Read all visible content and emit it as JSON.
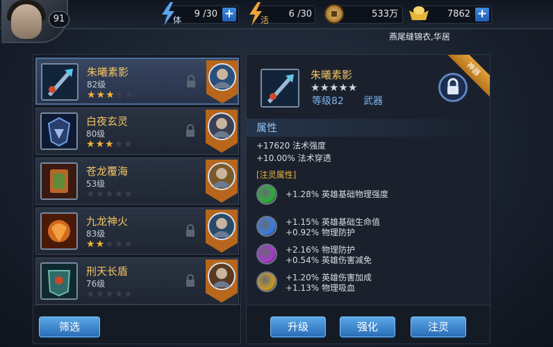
{
  "player": {
    "level": "91"
  },
  "resources": {
    "stamina": {
      "label": "体",
      "value": "9 /30"
    },
    "energy": {
      "label": "活",
      "value": "6 /30"
    },
    "gold": {
      "value": "533万"
    },
    "ingot": {
      "value": "7862"
    }
  },
  "notice": "燕尾缝锦衣,华居",
  "items": [
    {
      "name": "朱曦素影",
      "level": "82级",
      "stars": 3,
      "locked": true
    },
    {
      "name": "白夜玄灵",
      "level": "80级",
      "stars": 3,
      "locked": true
    },
    {
      "name": "苍龙覆海",
      "level": "53级",
      "stars": 0,
      "locked": false
    },
    {
      "name": "九龙神火",
      "level": "83级",
      "stars": 2,
      "locked": true
    },
    {
      "name": "刑天长盾",
      "level": "76级",
      "stars": 0,
      "locked": true
    }
  ],
  "filter_label": "筛选",
  "detail": {
    "ribbon": "神器",
    "name": "朱曦素影",
    "stars": 3,
    "level": "等级82",
    "type": "武器",
    "section_title": "属性",
    "attrs": [
      "+17620 法术强度",
      "+10.00% 法术穿透"
    ],
    "spirit_title": "[注灵属性]",
    "spirit": [
      {
        "lines": [
          "+1.28% 英雄基础物理强度"
        ],
        "color": "#2fae3a"
      },
      {
        "lines": [
          "+1.15% 英雄基础生命值",
          "+0.92% 物理防护"
        ],
        "color": "#3a7de0"
      },
      {
        "lines": [
          "+2.16% 物理防护",
          "+0.54% 英雄伤害减免"
        ],
        "color": "#a53ac8"
      },
      {
        "lines": [
          "+1.20% 英雄伤害加成",
          "+1.13% 物理吸血"
        ],
        "color": "#c99a2a"
      }
    ]
  },
  "buttons": {
    "upgrade": "升级",
    "enhance": "强化",
    "infuse": "注灵"
  },
  "colors": {
    "accent": "#f2c462",
    "button": "#3a84d0"
  }
}
